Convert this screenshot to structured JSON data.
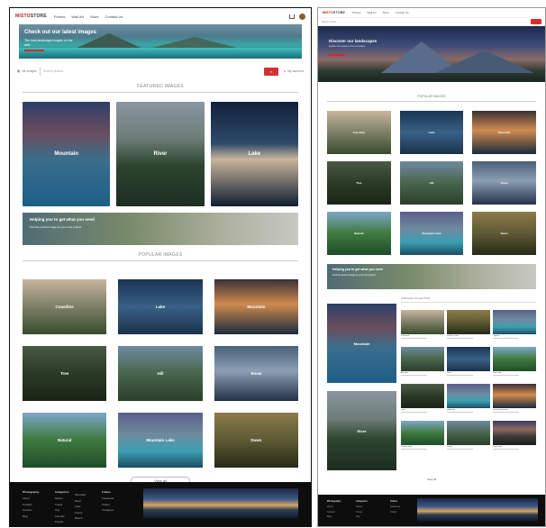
{
  "left": {
    "logo_a": "MISTO",
    "logo_b": "STORE",
    "nav": [
      "Photos",
      "Wall Art",
      "Store",
      "Contact Us"
    ],
    "hero": {
      "title": "Check out our latest images",
      "text": "The best landscape images on the web"
    },
    "search": {
      "category": "All Images",
      "placeholder": "Search photos",
      "button": "Go",
      "version": "My account"
    },
    "featured_title": "FEATURED IMAGES",
    "featured": [
      "Mountain",
      "River",
      "Lake"
    ],
    "banner": {
      "title": "Helping you to get what you need",
      "text": "Find the perfect image for your next project"
    },
    "popular_title": "POPULAR IMAGES",
    "popular": [
      "Coastline",
      "Lake",
      "Mountain",
      "Tree",
      "Hill",
      "Snow",
      "Natural",
      "Mountain Lake",
      "Dawn"
    ],
    "view_all": "View all",
    "footer": {
      "cols": [
        {
          "head": "Photography",
          "items": [
            "About",
            "Contact",
            "Careers",
            "Blog"
          ]
        },
        {
          "head": "Categories",
          "items": [
            "Nature",
            "Travel",
            "City",
            "Animals",
            "People"
          ]
        },
        {
          "head": "",
          "items": [
            "Mountain",
            "River",
            "Lake",
            "Forest",
            "Beach"
          ]
        },
        {
          "head": "Follow",
          "items": [
            "Facebook",
            "Twitter",
            "Instagram"
          ]
        }
      ]
    }
  },
  "right": {
    "logo_a": "MISTO",
    "logo_b": "STORE",
    "nav": [
      "Photos",
      "Wall Art",
      "Store",
      "Contact Us"
    ],
    "search_placeholder": "Search photos",
    "hero": {
      "title": "Discover our landscapes",
      "text": "Explore the beauty of the mountains"
    },
    "popular_title": "POPULAR IMAGES",
    "popular": [
      "Coastline",
      "Lake",
      "Mountain",
      "Tree",
      "Hill",
      "Snow",
      "Natural",
      "Mountain Lake",
      "Dawn"
    ],
    "banner": {
      "title": "Helping you to get what you need",
      "text": "Find the perfect image for your next project"
    },
    "featured": [
      "Mountain",
      "River"
    ],
    "grid_title": "POPULAR COLLECTION",
    "grid": [
      "Coastline",
      "Desert Coast",
      "Lagoon",
      "Alp Hills",
      "Lake",
      "Sea Lake",
      "Tree",
      "Mountain",
      "Sunset Mountain",
      "Coastal Hills",
      "Peaks",
      "Dusk Lake"
    ],
    "view_all": "View all",
    "footer": {
      "cols": [
        {
          "head": "Photography",
          "items": [
            "About",
            "Contact",
            "Blog"
          ]
        },
        {
          "head": "Categories",
          "items": [
            "Nature",
            "Travel",
            "City"
          ]
        },
        {
          "head": "Follow",
          "items": [
            "Facebook",
            "Twitter"
          ]
        }
      ]
    }
  }
}
